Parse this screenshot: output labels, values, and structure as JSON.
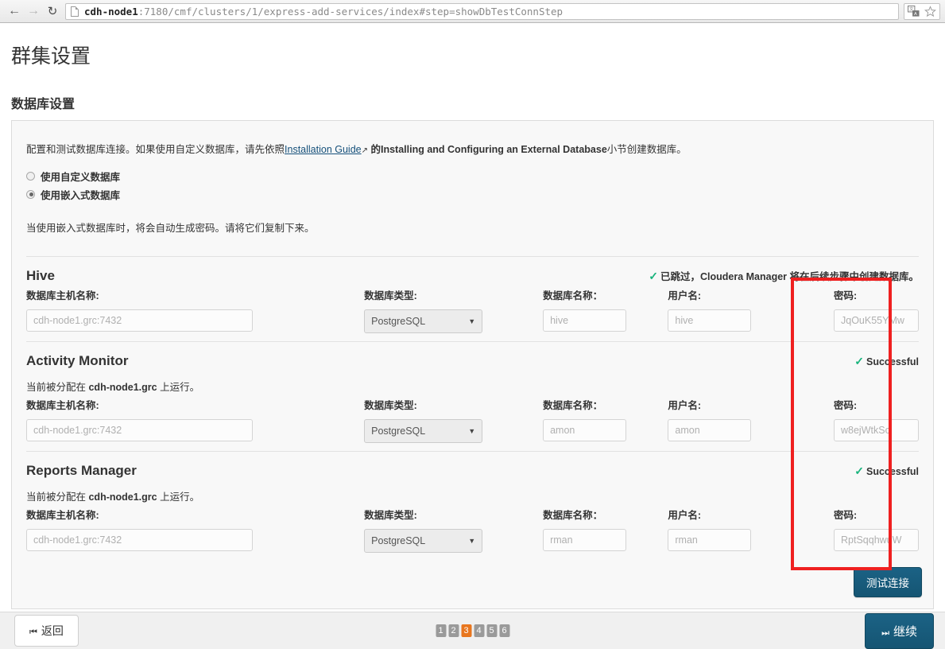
{
  "browser": {
    "back_icon": "arrow-left-icon",
    "forward_icon": "arrow-right-icon",
    "reload_icon": "reload-icon",
    "url_host": "cdh-node1",
    "url_path": ":7180/cmf/clusters/1/express-add-services/index#step=showDbTestConnStep",
    "translate_icon": "translate-icon",
    "bookmark_icon": "star-icon"
  },
  "page": {
    "title": "群集设置",
    "section_title": "数据库设置"
  },
  "intro": {
    "before_link": "配置和测试数据库连接。如果使用自定义数据库，请先依照",
    "link_text": "Installation Guide",
    "link_glyph": "↗",
    "after_link": "的",
    "bold_text": "Installing and Configuring an External Database",
    "tail": "小节创建数据库。"
  },
  "radios": [
    {
      "label": "使用自定义数据库",
      "checked": false
    },
    {
      "label": "使用嵌入式数据库",
      "checked": true
    }
  ],
  "note": "当使用嵌入式数据库时，将会自动生成密码。请将它们复制下来。",
  "field_labels": {
    "host": "数据库主机名称:",
    "type": "数据库类型:",
    "dbname": "数据库名称：",
    "user": "用户名:",
    "password": "密码:"
  },
  "services": [
    {
      "name": "Hive",
      "status": "已跳过，Cloudera Manager 将在后续步骤中创建数据库。",
      "status_icon": "check-icon",
      "assigned": null,
      "host_placeholder": "cdh-node1.grc:7432",
      "db_type": "PostgreSQL",
      "db_name": "hive",
      "username": "hive",
      "password": "JqOuK55YMw"
    },
    {
      "name": "Activity Monitor",
      "status": "Successful",
      "status_icon": "check-icon",
      "assigned_prefix": "当前被分配在 ",
      "assigned_host": "cdh-node1.grc",
      "assigned_suffix": " 上运行。",
      "host_placeholder": "cdh-node1.grc:7432",
      "db_type": "PostgreSQL",
      "db_name": "amon",
      "username": "amon",
      "password": "w8ejWtkScl"
    },
    {
      "name": "Reports Manager",
      "status": "Successful",
      "status_icon": "check-icon",
      "assigned_prefix": "当前被分配在 ",
      "assigned_host": "cdh-node1.grc",
      "assigned_suffix": " 上运行。",
      "host_placeholder": "cdh-node1.grc:7432",
      "db_type": "PostgreSQL",
      "db_name": "rman",
      "username": "rman",
      "password": "RptSqqhwuW"
    }
  ],
  "buttons": {
    "test_connection": "测试连接",
    "back": "返回",
    "back_glyph": "⏮",
    "next": "继续",
    "next_glyph": "⏭"
  },
  "pagination": {
    "pages": [
      "1",
      "2",
      "3",
      "4",
      "5",
      "6"
    ],
    "active": "3"
  },
  "colors": {
    "accent_blue": "#175a79",
    "active_page_orange": "#e8761e",
    "success_green": "#18b37c",
    "annotation_red": "#ef2020",
    "link_blue": "#15507a"
  }
}
